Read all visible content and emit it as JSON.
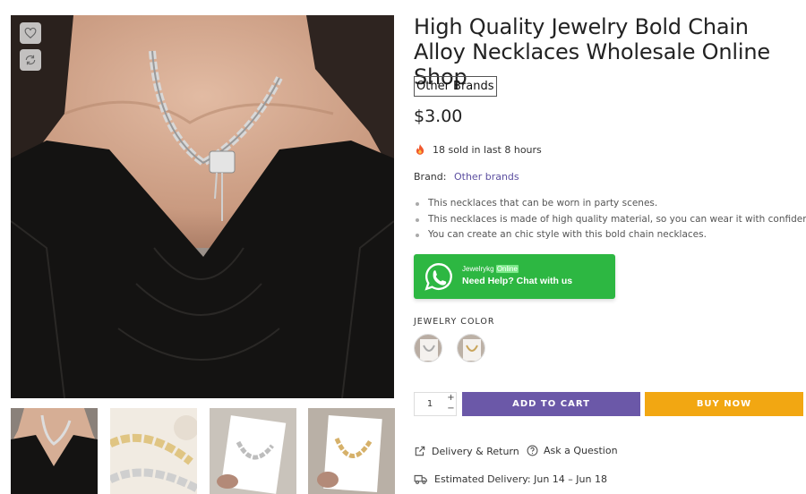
{
  "product": {
    "title": "High Quality Jewelry Bold Chain Alloy Necklaces Wholesale Online Shop",
    "brand_badge": "Other Brands",
    "price": "$3.00",
    "sold_text": "18 sold in last 8 hours",
    "brand_label": "Brand:",
    "brand_link": "Other brands",
    "features": [
      "This necklaces that can be worn in party scenes.",
      "This necklaces is made of high quality material, so you can wear it with confidence.",
      "You can create an chic style with this bold chain necklaces."
    ]
  },
  "whatsapp": {
    "name": "Jewelrykg",
    "status": "Online",
    "help": "Need Help? Chat with us",
    "color": "#2db742"
  },
  "options": {
    "color_label": "JEWELRY COLOR",
    "swatches": [
      "silver",
      "gold"
    ]
  },
  "cart": {
    "quantity": "1",
    "plus": "+",
    "minus": "−",
    "add_to_cart": "ADD TO CART",
    "buy_now": "BUY NOW",
    "add_color": "#6b58a8",
    "buy_color": "#f2a712"
  },
  "links": {
    "delivery": "Delivery & Return",
    "ask": "Ask a Question",
    "estimated": "Estimated Delivery: Jun 14 – Jun 18"
  },
  "icons": {
    "wishlist": "heart-icon",
    "compare": "refresh-icon",
    "fire": "fire-icon",
    "whatsapp": "whatsapp-icon",
    "delivery": "share-box-icon",
    "ask": "question-circle-icon",
    "truck": "truck-icon"
  }
}
